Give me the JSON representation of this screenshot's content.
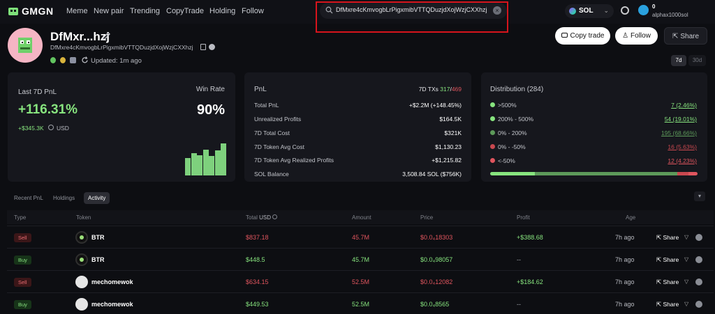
{
  "nav": {
    "logo": "GMGN",
    "items": [
      "Meme",
      "New pair",
      "Trending",
      "CopyTrade",
      "Holding",
      "Follow"
    ],
    "search_value": "DfMxre4cKmvogbLrPigxmibVTTQDuzjdXojWzjCXXhzj",
    "chain": "SOL",
    "account_balance": "0",
    "account_name": "alphax1000sol"
  },
  "wallet": {
    "name": "DfMxr...hzj",
    "address": "DfMxre4cKmvogbLrPigxmibVTTQDuzjdXojWzjCXXhzj",
    "updated": "Updated: 1m ago",
    "buttons": {
      "copy_trade": "Copy trade",
      "follow": "Follow",
      "share": "Share"
    },
    "timeframes": [
      "7d",
      "30d"
    ]
  },
  "pnl_card": {
    "title": "Last 7D PnL",
    "value": "+116.31%",
    "usd_value": "+$345.3K",
    "usd_unit": "USD",
    "win_rate_label": "Win Rate",
    "win_rate": "90%",
    "bars": [
      0.55,
      0.7,
      0.62,
      0.8,
      0.6,
      0.78,
      1.0
    ]
  },
  "stats_card": {
    "title": "PnL",
    "tx_label": "7D TXs",
    "tx_buy": "317",
    "tx_sep": "/",
    "tx_sell": "469",
    "rows": [
      {
        "label": "Total PnL",
        "value": "+$2.2M (+148.45%)"
      },
      {
        "label": "Unrealized Profits",
        "value": "$164.5K"
      },
      {
        "label": "7D Total Cost",
        "value": "$321K"
      },
      {
        "label": "7D Token Avg Cost",
        "value": "$1,130.23"
      },
      {
        "label": "7D Token Avg Realized Profits",
        "value": "+$1,215.82"
      },
      {
        "label": "SOL Balance",
        "value": "3,508.84 SOL ($756K)"
      }
    ]
  },
  "distribution": {
    "title": "Distribution (284)",
    "rows": [
      {
        "label": ">500%",
        "value": "7 (2.46%)",
        "color": "#87e47e"
      },
      {
        "label": "200% - 500%",
        "value": "54 (19.01%)",
        "color": "#87e47e"
      },
      {
        "label": "0% - 200%",
        "value": "195 (68.66%)",
        "color": "#5d9a5a"
      },
      {
        "label": "0% - -50%",
        "value": "16 (5.63%)",
        "color": "#c9484f"
      },
      {
        "label": "<-50%",
        "value": "12 (4.23%)",
        "color": "#e0555e"
      }
    ]
  },
  "tabs": [
    "Recent PnL",
    "Holdings",
    "Activity"
  ],
  "table": {
    "headers": {
      "type": "Type",
      "token": "Token",
      "total": "Total",
      "total_unit": "USD",
      "amount": "Amount",
      "price": "Price",
      "profit": "Profit",
      "age": "Age"
    },
    "share_label": "Share",
    "rows": [
      {
        "type": "Sell",
        "token": "BTR",
        "total": "$837.18",
        "amount": "45.7M",
        "price": "$0.0₄18303",
        "profit": "+$388.68",
        "age": "7h ago"
      },
      {
        "type": "Buy",
        "token": "BTR",
        "total": "$448.5",
        "amount": "45.7M",
        "price": "$0.0₄98057",
        "profit": "--",
        "age": "7h ago"
      },
      {
        "type": "Sell",
        "token": "mechomewok",
        "total": "$634.15",
        "amount": "52.5M",
        "price": "$0.0₄12082",
        "profit": "+$184.62",
        "age": "7h ago"
      },
      {
        "type": "Buy",
        "token": "mechomewok",
        "total": "$449.53",
        "amount": "52.5M",
        "price": "$0.0₄8565",
        "profit": "--",
        "age": "7h ago"
      }
    ]
  }
}
